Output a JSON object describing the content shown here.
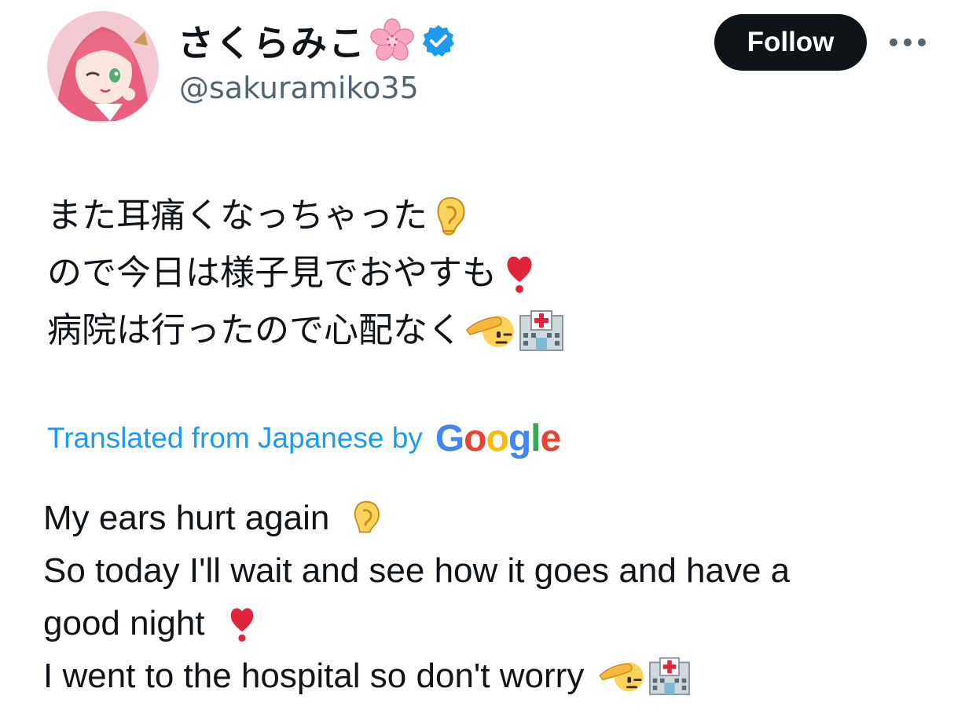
{
  "author": {
    "display_name": "さくらみこ",
    "name_emoji": "cherry-blossom-emoji",
    "verified": true,
    "handle": "@sakuramiko35",
    "avatar": "anime-avatar-pink-hair"
  },
  "actions": {
    "follow_label": "Follow",
    "more_icon": "more-horizontal-icon"
  },
  "tweet": {
    "original_lines": [
      {
        "text": "また耳痛くなっちゃった",
        "emojis": [
          "ear-emoji"
        ]
      },
      {
        "text": "ので今日は様子見でおやすも",
        "emojis": [
          "heavy-exclamation-emoji"
        ]
      },
      {
        "text": "病院は行ったので心配なく",
        "emojis": [
          "saluting-face-emoji",
          "hospital-emoji"
        ]
      }
    ],
    "translation_label": "Translated from Japanese by",
    "translation_provider": "Google",
    "translation_lines": [
      {
        "text": "My ears hurt again",
        "emojis": [
          "ear-emoji"
        ]
      },
      {
        "text": "So today I'll wait and see how it goes and have a",
        "emojis": []
      },
      {
        "text": "good night",
        "emojis": [
          "heavy-exclamation-emoji"
        ]
      },
      {
        "text": "I went to the hospital so don't worry",
        "emojis": [
          "saluting-face-emoji",
          "hospital-emoji"
        ]
      }
    ]
  },
  "colors": {
    "text": "#0f1419",
    "secondary_text": "#536471",
    "link": "#1d9bf0",
    "verified": "#1d9bf0",
    "button_bg": "#0f1419"
  }
}
